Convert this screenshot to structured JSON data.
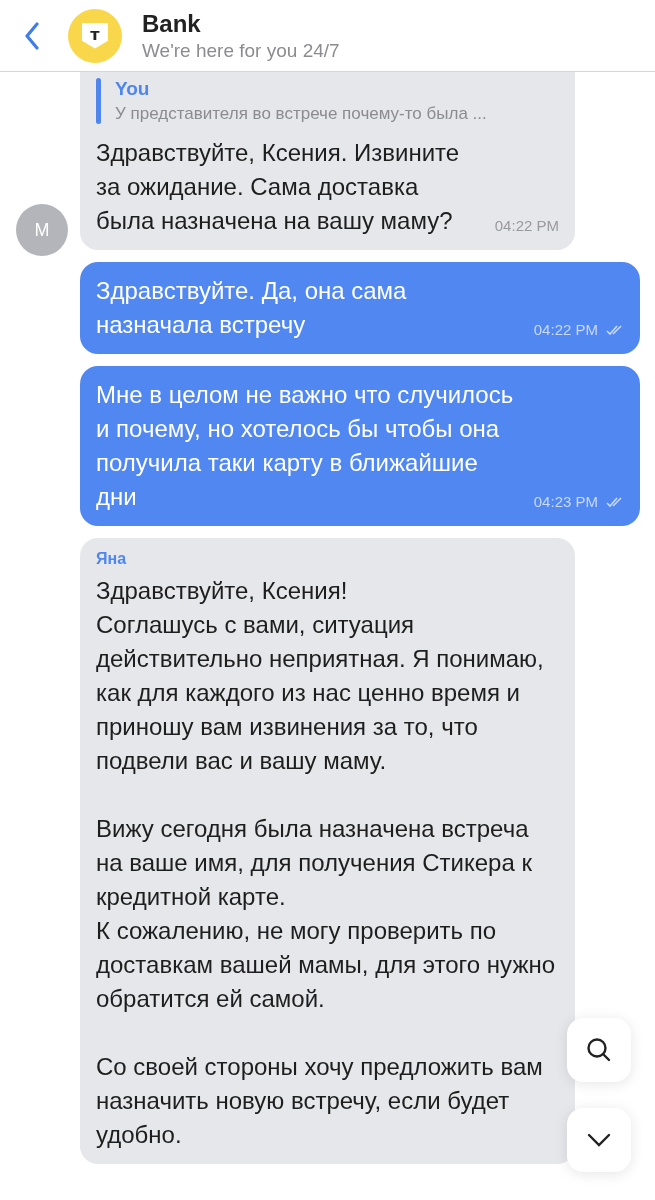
{
  "header": {
    "title": "Bank",
    "subtitle": "We're here for you 24/7",
    "avatar_letter": "т"
  },
  "messages": [
    {
      "kind": "incoming",
      "avatar": "M",
      "reply": {
        "author": "You",
        "text": "У представителя во встрече почему-то была ..."
      },
      "text": "Здравствуйте, Ксения. Извините за ожидание. Сама доставка была назначена на вашу маму?",
      "time": "04:22 PM"
    },
    {
      "kind": "outgoing",
      "text": "Здравствуйте. Да, она сама назначала встречу",
      "time": "04:22 PM",
      "read": true
    },
    {
      "kind": "outgoing",
      "text": "Мне в целом не важно что случилось и почему, но хотелось бы чтобы она получила таки карту в ближайшие дни",
      "time": "04:23 PM",
      "read": true
    },
    {
      "kind": "incoming",
      "author": "Яна",
      "text": "Здравствуйте, Ксения!\nСоглашусь с вами, ситуация действительно неприятная. Я понимаю, как для каждого из нас ценно время и приношу вам извинения за то, что подвели вас и вашу маму.\n\nВижу сегодня была назначена встреча на ваше имя, для получения Стикера к кредитной карте.\nК сожалению, не могу проверить по доставкам вашей мамы, для этого нужно обратится ей самой.\n\nСо своей стороны хочу предложить вам назначить новую встречу, если будет удобно."
    }
  ]
}
